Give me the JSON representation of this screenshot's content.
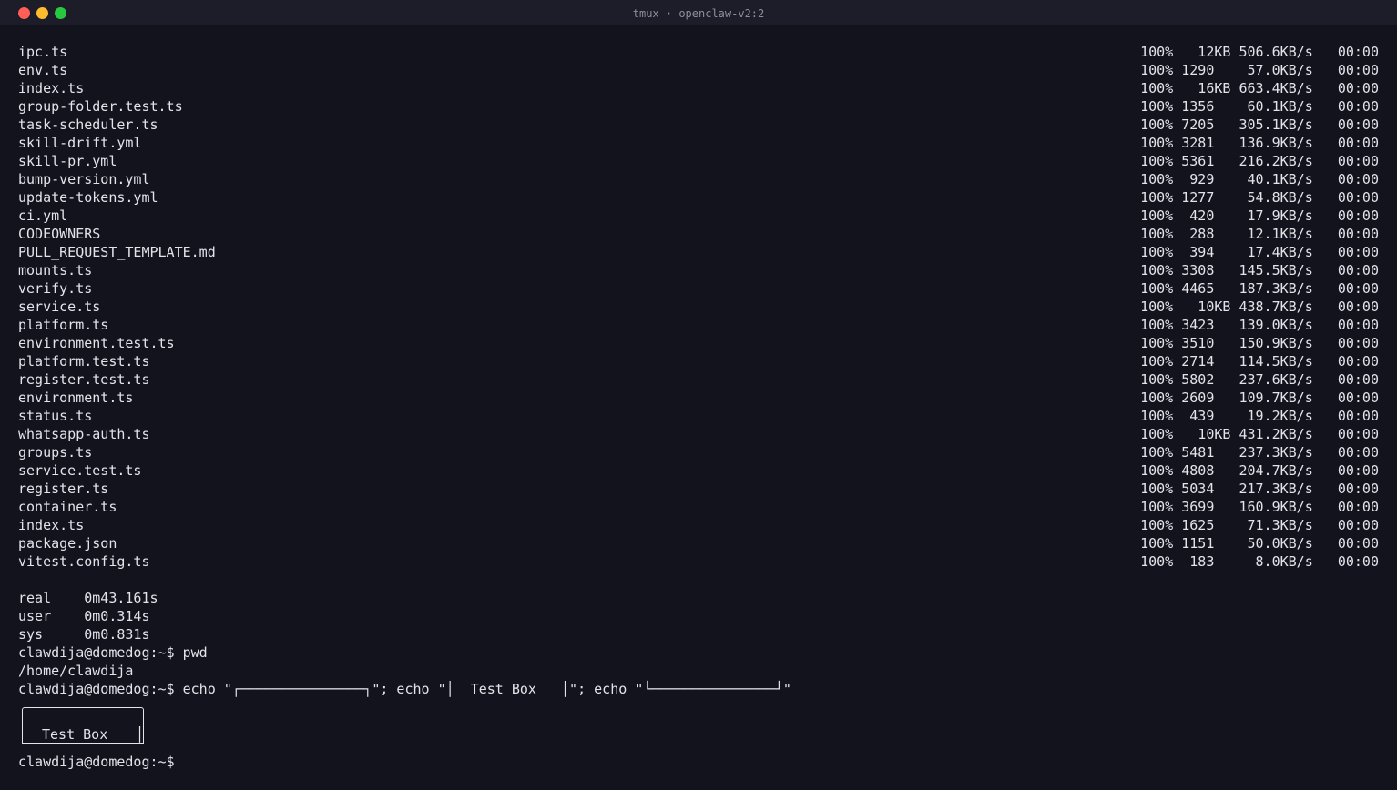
{
  "window": {
    "title": "tmux · openclaw-v2:2"
  },
  "transfers": [
    {
      "file": "ipc.ts",
      "stat": "100%   12KB 506.6KB/s   00:00"
    },
    {
      "file": "env.ts",
      "stat": "100% 1290    57.0KB/s   00:00"
    },
    {
      "file": "index.ts",
      "stat": "100%   16KB 663.4KB/s   00:00"
    },
    {
      "file": "group-folder.test.ts",
      "stat": "100% 1356    60.1KB/s   00:00"
    },
    {
      "file": "task-scheduler.ts",
      "stat": "100% 7205   305.1KB/s   00:00"
    },
    {
      "file": "skill-drift.yml",
      "stat": "100% 3281   136.9KB/s   00:00"
    },
    {
      "file": "skill-pr.yml",
      "stat": "100% 5361   216.2KB/s   00:00"
    },
    {
      "file": "bump-version.yml",
      "stat": "100%  929    40.1KB/s   00:00"
    },
    {
      "file": "update-tokens.yml",
      "stat": "100% 1277    54.8KB/s   00:00"
    },
    {
      "file": "ci.yml",
      "stat": "100%  420    17.9KB/s   00:00"
    },
    {
      "file": "CODEOWNERS",
      "stat": "100%  288    12.1KB/s   00:00"
    },
    {
      "file": "PULL_REQUEST_TEMPLATE.md",
      "stat": "100%  394    17.4KB/s   00:00"
    },
    {
      "file": "mounts.ts",
      "stat": "100% 3308   145.5KB/s   00:00"
    },
    {
      "file": "verify.ts",
      "stat": "100% 4465   187.3KB/s   00:00"
    },
    {
      "file": "service.ts",
      "stat": "100%   10KB 438.7KB/s   00:00"
    },
    {
      "file": "platform.ts",
      "stat": "100% 3423   139.0KB/s   00:00"
    },
    {
      "file": "environment.test.ts",
      "stat": "100% 3510   150.9KB/s   00:00"
    },
    {
      "file": "platform.test.ts",
      "stat": "100% 2714   114.5KB/s   00:00"
    },
    {
      "file": "register.test.ts",
      "stat": "100% 5802   237.6KB/s   00:00"
    },
    {
      "file": "environment.ts",
      "stat": "100% 2609   109.7KB/s   00:00"
    },
    {
      "file": "status.ts",
      "stat": "100%  439    19.2KB/s   00:00"
    },
    {
      "file": "whatsapp-auth.ts",
      "stat": "100%   10KB 431.2KB/s   00:00"
    },
    {
      "file": "groups.ts",
      "stat": "100% 5481   237.3KB/s   00:00"
    },
    {
      "file": "service.test.ts",
      "stat": "100% 4808   204.7KB/s   00:00"
    },
    {
      "file": "register.ts",
      "stat": "100% 5034   217.3KB/s   00:00"
    },
    {
      "file": "container.ts",
      "stat": "100% 3699   160.9KB/s   00:00"
    },
    {
      "file": "index.ts",
      "stat": "100% 1625    71.3KB/s   00:00"
    },
    {
      "file": "package.json",
      "stat": "100% 1151    50.0KB/s   00:00"
    },
    {
      "file": "vitest.config.ts",
      "stat": "100%  183     8.0KB/s   00:00"
    }
  ],
  "timing": {
    "real": "real\t0m43.161s",
    "user": "user\t0m0.314s",
    "sys": "sys\t0m0.831s"
  },
  "session": {
    "pwd_cmd": "clawdija@domedog:~$ pwd",
    "pwd_out": "/home/clawdija",
    "echo_cmd": "clawdija@domedog:~$ echo \"┌───────────────┐\"; echo \"│  Test Box   │\"; echo \"└───────────────┘\"",
    "box_text": "Test Box",
    "box_right_bar": "│",
    "prompt": "clawdija@domedog:~$ "
  }
}
